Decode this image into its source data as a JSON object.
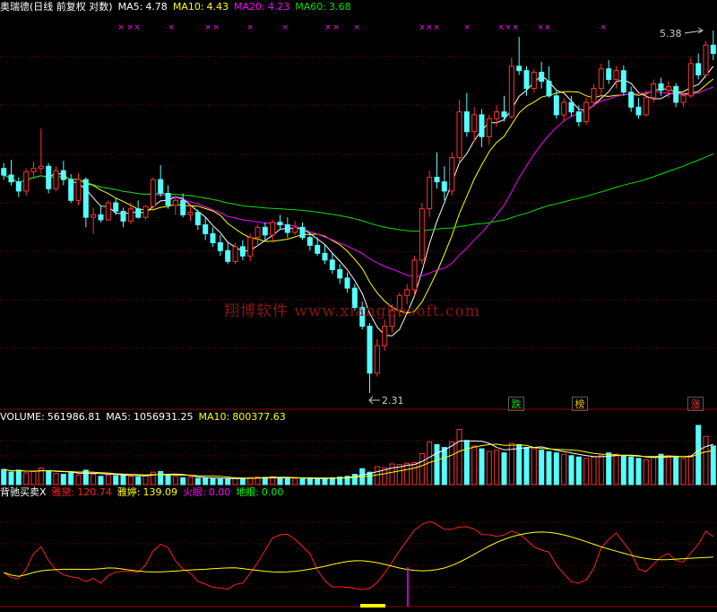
{
  "colors": {
    "background": "#000000",
    "grid": "#8b0000",
    "up": "#ff3232",
    "down": "#54ffff",
    "ma5": "#ffffff",
    "ma10": "#ffff00",
    "ma20": "#ff00ff",
    "ma60": "#00e000",
    "yanian": "#ff2020",
    "yating": "#ffff00",
    "huoyan": "#ff00ff",
    "diyan": "#00ff00"
  },
  "main_legend": {
    "title": "奥瑞德(日线 前复权 对数)",
    "ma5_label": "MA5:",
    "ma5_value": "4.78",
    "ma10_label": "MA10:",
    "ma10_value": "4.43",
    "ma20_label": "MA20:",
    "ma20_value": "4.23",
    "ma60_label": "MA60:",
    "ma60_value": "3.68"
  },
  "volume_legend": {
    "label": "VOLUME:",
    "value": "561986.81",
    "ma5_label": "MA5:",
    "ma5_value": "1056931.25",
    "ma10_label": "MA10:",
    "ma10_value": "800377.63"
  },
  "indicator_legend": {
    "title": "背驰买卖X",
    "yanian_label": "雅黛:",
    "yanian_value": "120.74",
    "yating_label": "雅婷:",
    "yating_value": "139.09",
    "huoyan_label": "火眼:",
    "huoyan_value": "0.00",
    "diyan_label": "地眼:",
    "diyan_value": "0.00"
  },
  "annotations": {
    "high_label": "5.38",
    "low_label": "2.31",
    "tag_fall": "跌",
    "tag_list": "榜",
    "tag_rise": "涨",
    "watermark": "翔博软件 www.xiangbosoft.com"
  },
  "chart_data": {
    "type": "candlestick",
    "scale": "log",
    "ma_periods": [
      5,
      10,
      20,
      60
    ],
    "candles": [
      [
        3.9,
        3.95,
        3.8,
        3.84
      ],
      [
        3.84,
        3.98,
        3.75,
        3.78
      ],
      [
        3.78,
        3.82,
        3.65,
        3.7
      ],
      [
        3.7,
        3.9,
        3.66,
        3.87
      ],
      [
        3.87,
        3.96,
        3.82,
        3.9
      ],
      [
        3.9,
        4.28,
        3.85,
        3.92
      ],
      [
        3.92,
        3.95,
        3.68,
        3.72
      ],
      [
        3.72,
        3.92,
        3.7,
        3.88
      ],
      [
        3.88,
        3.97,
        3.75,
        3.8
      ],
      [
        3.8,
        3.85,
        3.6,
        3.62
      ],
      [
        3.62,
        3.86,
        3.58,
        3.8
      ],
      [
        3.8,
        3.82,
        3.4,
        3.48
      ],
      [
        3.48,
        3.56,
        3.35,
        3.5
      ],
      [
        3.5,
        3.58,
        3.44,
        3.46
      ],
      [
        3.46,
        3.62,
        3.45,
        3.6
      ],
      [
        3.6,
        3.64,
        3.5,
        3.53
      ],
      [
        3.53,
        3.56,
        3.4,
        3.45
      ],
      [
        3.45,
        3.6,
        3.43,
        3.55
      ],
      [
        3.55,
        3.62,
        3.47,
        3.48
      ],
      [
        3.48,
        3.58,
        3.46,
        3.57
      ],
      [
        3.57,
        3.82,
        3.55,
        3.8
      ],
      [
        3.8,
        3.93,
        3.65,
        3.68
      ],
      [
        3.68,
        3.75,
        3.55,
        3.58
      ],
      [
        3.58,
        3.66,
        3.5,
        3.62
      ],
      [
        3.62,
        3.68,
        3.48,
        3.5
      ],
      [
        3.5,
        3.58,
        3.45,
        3.52
      ],
      [
        3.52,
        3.54,
        3.38,
        3.42
      ],
      [
        3.42,
        3.48,
        3.3,
        3.35
      ],
      [
        3.35,
        3.4,
        3.25,
        3.28
      ],
      [
        3.28,
        3.34,
        3.18,
        3.22
      ],
      [
        3.22,
        3.28,
        3.12,
        3.14
      ],
      [
        3.14,
        3.28,
        3.12,
        3.25
      ],
      [
        3.25,
        3.3,
        3.15,
        3.18
      ],
      [
        3.18,
        3.35,
        3.14,
        3.32
      ],
      [
        3.32,
        3.42,
        3.25,
        3.4
      ],
      [
        3.4,
        3.44,
        3.3,
        3.34
      ],
      [
        3.34,
        3.46,
        3.28,
        3.44
      ],
      [
        3.44,
        3.5,
        3.38,
        3.42
      ],
      [
        3.42,
        3.48,
        3.32,
        3.36
      ],
      [
        3.36,
        3.45,
        3.34,
        3.4
      ],
      [
        3.4,
        3.44,
        3.3,
        3.32
      ],
      [
        3.32,
        3.36,
        3.22,
        3.26
      ],
      [
        3.26,
        3.32,
        3.18,
        3.2
      ],
      [
        3.2,
        3.26,
        3.12,
        3.15
      ],
      [
        3.15,
        3.2,
        3.05,
        3.08
      ],
      [
        3.08,
        3.12,
        2.98,
        3.02
      ],
      [
        3.02,
        3.06,
        2.92,
        2.95
      ],
      [
        2.95,
        2.98,
        2.8,
        2.82
      ],
      [
        2.82,
        2.86,
        2.68,
        2.7
      ],
      [
        2.7,
        2.72,
        2.31,
        2.42
      ],
      [
        2.42,
        2.62,
        2.4,
        2.58
      ],
      [
        2.58,
        2.74,
        2.55,
        2.7
      ],
      [
        2.7,
        2.84,
        2.66,
        2.8
      ],
      [
        2.8,
        2.92,
        2.76,
        2.9
      ],
      [
        2.9,
        2.98,
        2.84,
        2.94
      ],
      [
        2.94,
        3.18,
        2.9,
        3.15
      ],
      [
        3.15,
        3.6,
        3.12,
        3.55
      ],
      [
        3.55,
        3.88,
        3.48,
        3.82
      ],
      [
        3.82,
        4.05,
        3.72,
        3.78
      ],
      [
        3.78,
        3.92,
        3.62,
        3.7
      ],
      [
        3.7,
        4.05,
        3.66,
        4.0
      ],
      [
        4.0,
        4.58,
        3.95,
        4.45
      ],
      [
        4.45,
        4.65,
        4.2,
        4.25
      ],
      [
        4.25,
        4.5,
        4.15,
        4.42
      ],
      [
        4.42,
        4.48,
        4.1,
        4.2
      ],
      [
        4.2,
        4.42,
        4.12,
        4.38
      ],
      [
        4.38,
        4.52,
        4.3,
        4.45
      ],
      [
        4.45,
        4.62,
        4.35,
        4.4
      ],
      [
        4.4,
        5.05,
        4.38,
        4.95
      ],
      [
        4.95,
        5.3,
        4.85,
        4.9
      ],
      [
        4.9,
        4.95,
        4.62,
        4.7
      ],
      [
        4.7,
        4.92,
        4.65,
        4.88
      ],
      [
        4.88,
        5.0,
        4.7,
        4.78
      ],
      [
        4.78,
        4.95,
        4.6,
        4.62
      ],
      [
        4.62,
        4.68,
        4.38,
        4.42
      ],
      [
        4.42,
        4.6,
        4.35,
        4.55
      ],
      [
        4.55,
        4.62,
        4.4,
        4.45
      ],
      [
        4.45,
        4.52,
        4.3,
        4.35
      ],
      [
        4.35,
        4.6,
        4.32,
        4.55
      ],
      [
        4.55,
        4.75,
        4.5,
        4.7
      ],
      [
        4.7,
        4.98,
        4.62,
        4.92
      ],
      [
        4.92,
        5.02,
        4.75,
        4.8
      ],
      [
        4.8,
        4.95,
        4.7,
        4.9
      ],
      [
        4.9,
        4.96,
        4.62,
        4.66
      ],
      [
        4.66,
        4.72,
        4.45,
        4.5
      ],
      [
        4.5,
        4.6,
        4.38,
        4.42
      ],
      [
        4.42,
        4.68,
        4.4,
        4.6
      ],
      [
        4.6,
        4.8,
        4.55,
        4.75
      ],
      [
        4.75,
        4.82,
        4.62,
        4.68
      ],
      [
        4.68,
        4.78,
        4.6,
        4.72
      ],
      [
        4.72,
        4.76,
        4.5,
        4.55
      ],
      [
        4.55,
        4.65,
        4.5,
        4.62
      ],
      [
        4.62,
        5.05,
        4.6,
        4.98
      ],
      [
        4.98,
        5.1,
        4.8,
        4.85
      ],
      [
        4.85,
        5.25,
        4.82,
        5.2
      ],
      [
        5.2,
        5.38,
        5.02,
        5.1
      ]
    ],
    "volume": [
      220,
      180,
      210,
      170,
      190,
      240,
      200,
      160,
      150,
      170,
      140,
      210,
      150,
      120,
      140,
      130,
      150,
      120,
      110,
      130,
      180,
      190,
      140,
      120,
      100,
      110,
      90,
      95,
      85,
      80,
      90,
      85,
      95,
      100,
      110,
      105,
      115,
      100,
      95,
      90,
      85,
      80,
      90,
      95,
      100,
      110,
      120,
      150,
      230,
      180,
      260,
      240,
      300,
      290,
      310,
      320,
      450,
      620,
      580,
      540,
      620,
      800,
      640,
      560,
      520,
      480,
      500,
      460,
      600,
      580,
      540,
      520,
      500,
      480,
      460,
      440,
      420,
      400,
      380,
      400,
      420,
      460,
      440,
      420,
      400,
      380,
      360,
      400,
      440,
      420,
      400,
      380,
      420,
      860,
      700,
      562
    ]
  }
}
